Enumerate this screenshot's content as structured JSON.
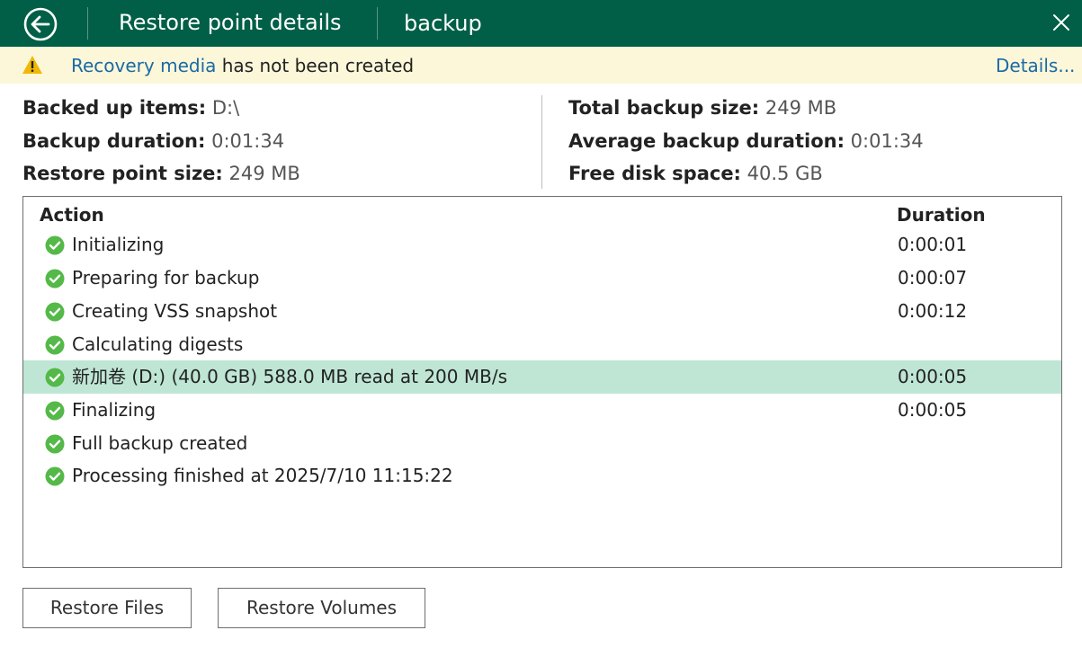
{
  "titlebar": {
    "title": "Restore point details",
    "job_name": "backup",
    "back_icon": "back-arrow-icon",
    "close_icon": "close-icon",
    "bg_color": "#005f46"
  },
  "warning": {
    "icon": "warning-icon",
    "link_text": "Recovery media",
    "message": " has not been created",
    "details_link": "Details..."
  },
  "info": {
    "left": [
      {
        "label": "Backed up items:",
        "value": "D:\\"
      },
      {
        "label": "Backup duration:",
        "value": "0:01:34"
      },
      {
        "label": "Restore point size:",
        "value": "249 MB"
      }
    ],
    "right": [
      {
        "label": "Total backup size:",
        "value": "249 MB"
      },
      {
        "label": "Average backup duration:",
        "value": "0:01:34"
      },
      {
        "label": "Free disk space:",
        "value": "40.5 GB"
      }
    ]
  },
  "log": {
    "columns": {
      "action": "Action",
      "duration": "Duration"
    },
    "status_icon": "success-check-icon",
    "rows": [
      {
        "action": "Initializing",
        "duration": "0:00:01"
      },
      {
        "action": "Preparing for backup",
        "duration": "0:00:07"
      },
      {
        "action": "Creating VSS snapshot",
        "duration": "0:00:12"
      },
      {
        "action": "Calculating digests",
        "duration": ""
      },
      {
        "action": "新加卷 (D:) (40.0 GB) 588.0 MB read at 200 MB/s",
        "duration": "0:00:05",
        "selected": true
      },
      {
        "action": "Finalizing",
        "duration": "0:00:05"
      },
      {
        "action": "Full backup created",
        "duration": ""
      },
      {
        "action": "Processing finished at 2025/7/10 11:15:22",
        "duration": ""
      }
    ]
  },
  "buttons": {
    "restore_files": "Restore Files",
    "restore_volumes": "Restore Volumes"
  }
}
